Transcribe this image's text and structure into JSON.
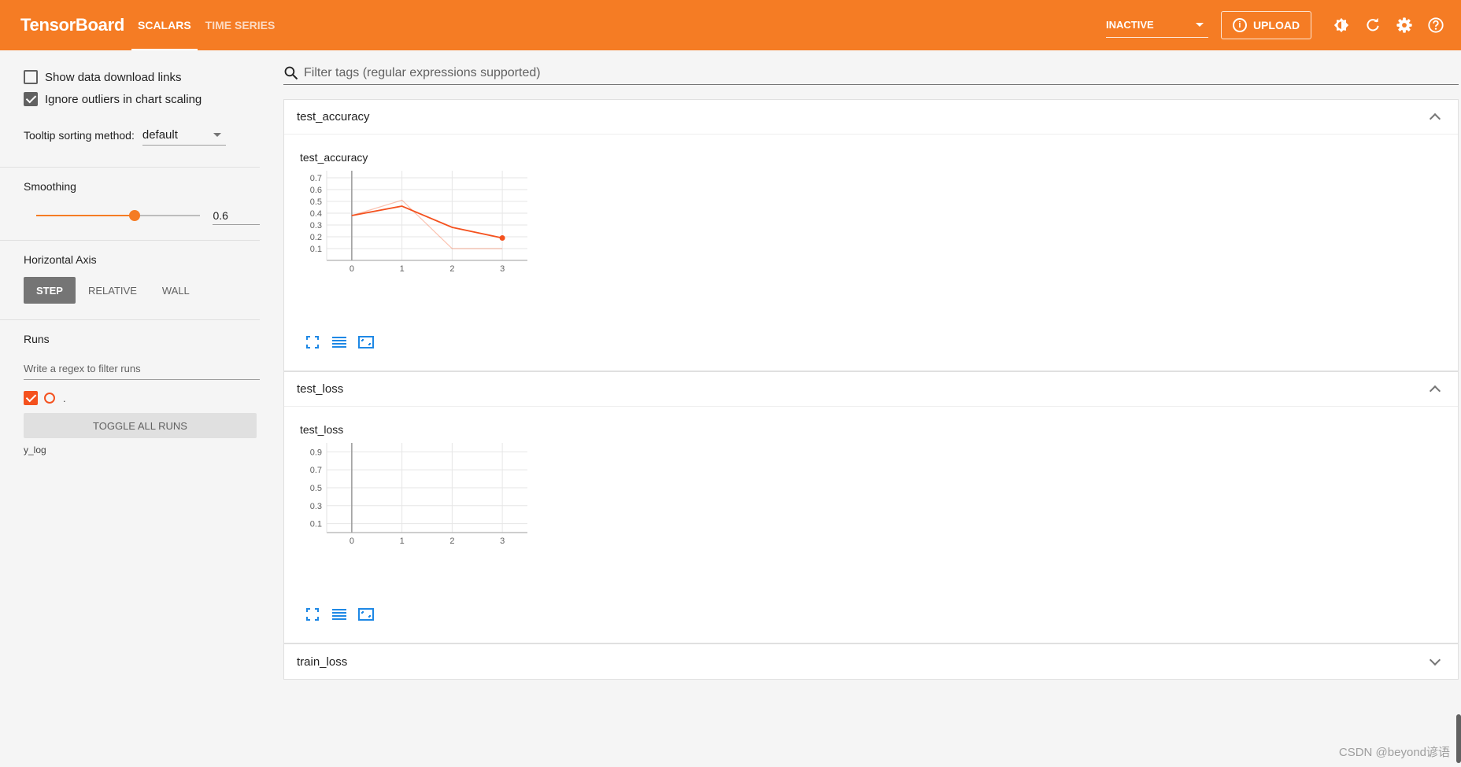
{
  "header": {
    "brand": "TensorBoard",
    "tabs": [
      {
        "label": "SCALARS",
        "active": true
      },
      {
        "label": "TIME SERIES",
        "active": false
      }
    ],
    "status_select": "INACTIVE",
    "upload_label": "UPLOAD"
  },
  "sidebar": {
    "show_download_links": {
      "label": "Show data download links",
      "checked": false
    },
    "ignore_outliers": {
      "label": "Ignore outliers in chart scaling",
      "checked": true
    },
    "tooltip_label": "Tooltip sorting method:",
    "tooltip_value": "default",
    "smoothing_label": "Smoothing",
    "smoothing_value": "0.6",
    "smoothing_fraction": 0.6,
    "horizontal_axis_label": "Horizontal Axis",
    "axis_options": [
      "STEP",
      "RELATIVE",
      "WALL"
    ],
    "axis_selected": "STEP",
    "runs_label": "Runs",
    "runs_filter_placeholder": "Write a regex to filter runs",
    "run_name": ".",
    "run_color": "#f4511e",
    "toggle_all_label": "TOGGLE ALL RUNS",
    "run_dir": "y_log"
  },
  "main": {
    "filter_placeholder": "Filter tags (regular expressions supported)",
    "cards": [
      {
        "title": "test_accuracy",
        "expanded": true
      },
      {
        "title": "test_loss",
        "expanded": true
      },
      {
        "title": "train_loss",
        "expanded": false
      }
    ]
  },
  "watermark": "CSDN @beyond谚语",
  "colors": {
    "accent": "#f57c24",
    "run": "#f4511e",
    "tool_icon": "#1e88e5"
  },
  "chart_data": [
    {
      "type": "line",
      "title": "test_accuracy",
      "x": [
        0,
        1,
        2,
        3
      ],
      "series": [
        {
          "values": [
            0.38,
            0.46,
            0.28,
            0.19
          ],
          "smoothed": true
        },
        {
          "values": [
            0.38,
            0.51,
            0.1,
            0.1
          ],
          "smoothed": false
        }
      ],
      "xticks": [
        "0",
        "1",
        "2",
        "3"
      ],
      "yticks": [
        "0.1",
        "0.2",
        "0.3",
        "0.4",
        "0.5",
        "0.6",
        "0.7"
      ],
      "ytick_values": [
        0.1,
        0.2,
        0.3,
        0.4,
        0.5,
        0.6,
        0.7
      ],
      "xlim": [
        -0.5,
        3.5
      ],
      "ylim": [
        0.0,
        0.76
      ],
      "grid": true
    },
    {
      "type": "line",
      "title": "test_loss",
      "x": [
        0,
        1,
        2,
        3
      ],
      "series": [],
      "xticks": [
        "0",
        "1",
        "2",
        "3"
      ],
      "yticks": [
        "0.1",
        "0.3",
        "0.5",
        "0.7",
        "0.9"
      ],
      "ytick_values": [
        0.1,
        0.3,
        0.5,
        0.7,
        0.9
      ],
      "xlim": [
        -0.5,
        3.5
      ],
      "ylim": [
        0.0,
        1.0
      ],
      "grid": true
    }
  ]
}
